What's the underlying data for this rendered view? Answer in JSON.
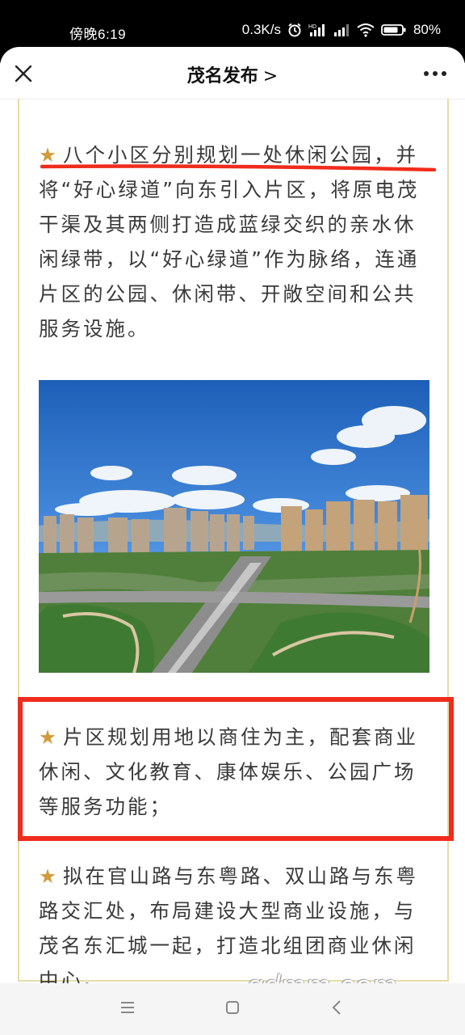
{
  "status_bar": {
    "time": "傍晚6:19",
    "network_speed": "0.3K/s",
    "battery": "80%"
  },
  "header": {
    "title": "茂名发布",
    "chevron": ">"
  },
  "article": {
    "star": "★",
    "paragraphs": [
      "八个小区分别规划一处休闲公园，并将“好心绿道”向东引入片区，将原电茂干渠及其两侧打造成蓝绿交织的亲水休闲绿带，以“好心绿道”作为脉络，连通片区的公园、休闲带、开敞空间和公共服务设施。",
      "片区规划用地以商住为主，配套商业休闲、文化教育、康体娱乐、公园广场等服务功能；",
      "拟在官山路与东粤路、双山路与东粤路交汇处，布局建设大型商业设施，与茂名东汇城一起，打造北组团商业休闲中心。"
    ]
  },
  "watermark": "gdmm.com",
  "colors": {
    "star": "#d29a3c",
    "highlight_red": "#f02c1c",
    "border_gold": "#e6dca8"
  }
}
